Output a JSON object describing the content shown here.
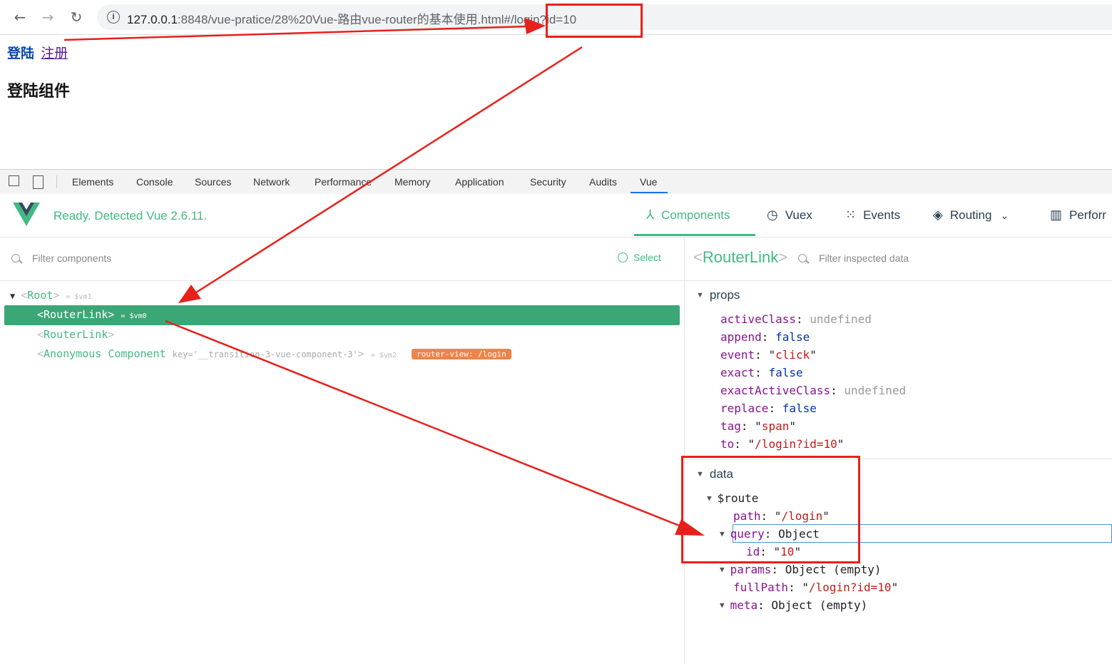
{
  "browser": {
    "back_icon": "arrow-left-icon",
    "forward_icon": "arrow-right-icon",
    "reload_icon": "reload-icon",
    "url_host": "127.0.0.1",
    "url_rest": ":8848/vue-pratice/28%20Vue-路由vue-router的基本使用.html#/login?id=10"
  },
  "page": {
    "link_login": "登陆",
    "link_register": "注册",
    "heading": "登陆组件"
  },
  "devtools": {
    "tabs": [
      "Elements",
      "Console",
      "Sources",
      "Network",
      "Performance",
      "Memory",
      "Application",
      "Security",
      "Audits",
      "Vue"
    ],
    "active_tab": "Vue"
  },
  "vue": {
    "status": "Ready. Detected Vue 2.6.11.",
    "nav": {
      "components": "Components",
      "vuex": "Vuex",
      "events": "Events",
      "routing": "Routing",
      "performance": "Perforr"
    },
    "filter_placeholder": "Filter components",
    "select_label": "Select",
    "tree": {
      "root_name": "Root",
      "root_ref": "= $vm1",
      "routerlink1_name": "RouterLink",
      "routerlink1_ref": "= $vm0",
      "routerlink2_name": "RouterLink",
      "anon_name": "Anonymous Component",
      "anon_key": "key='__transition-3-vue-component-3'",
      "anon_ref": "= $vm2",
      "anon_badge": "router-view: /login"
    },
    "inspector": {
      "title": "RouterLink",
      "filter_placeholder": "Filter inspected data",
      "props_title": "props",
      "props": {
        "activeClass_k": "activeClass",
        "activeClass_v": "undefined",
        "append_k": "append",
        "append_v": "false",
        "event_k": "event",
        "event_v": "click",
        "exact_k": "exact",
        "exact_v": "false",
        "exactActiveClass_k": "exactActiveClass",
        "exactActiveClass_v": "undefined",
        "replace_k": "replace",
        "replace_v": "false",
        "tag_k": "tag",
        "tag_v": "span",
        "to_k": "to",
        "to_v": "/login?id=10"
      },
      "data_title": "data",
      "route_k": "$route",
      "path_k": "path",
      "path_v": "/login",
      "query_k": "query",
      "query_v": "Object",
      "id_k": "id",
      "id_v": "10",
      "params_k": "params",
      "params_v": "Object (empty)",
      "fullPath_k": "fullPath",
      "fullPath_v": "/login?id=10",
      "meta_k": "meta",
      "meta_v": "Object (empty)"
    }
  },
  "colors": {
    "vue_green": "#42b983",
    "selected_row": "#3ba776",
    "annotation_red": "#e8201b",
    "badge_orange": "#f0834a"
  }
}
